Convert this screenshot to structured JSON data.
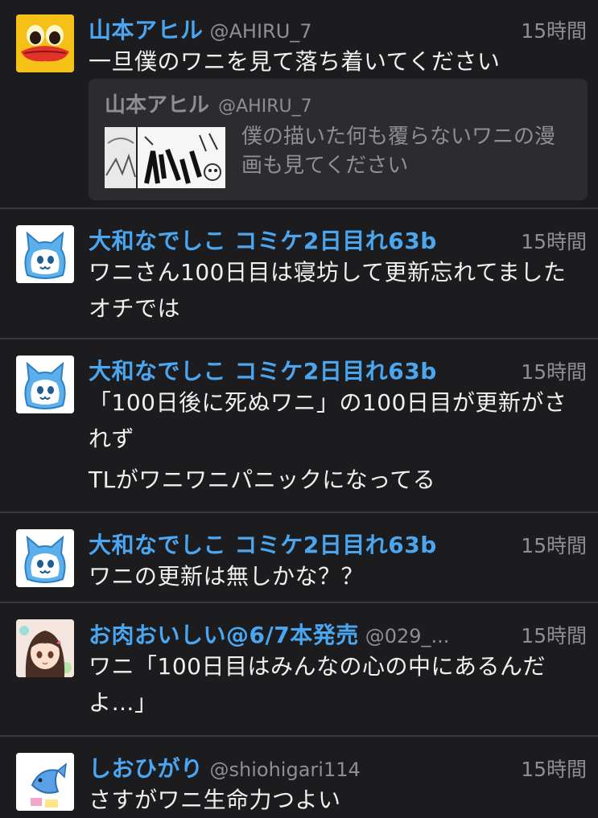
{
  "tweets": [
    {
      "name": "山本アヒル",
      "handle": "@AHIRU_7",
      "time": "15時間",
      "avatar": "duck-avatar",
      "text": [
        "一旦僕のワニを見て落ち着いてください"
      ],
      "quote": {
        "name": "山本アヒル",
        "handle": "@AHIRU_7",
        "text": "僕の描いた何も覆らないワニの漫画も見てください",
        "thumb": "manga-thumbnail"
      }
    },
    {
      "name": "大和なでしこ コミケ2日目れ63b",
      "handle": "",
      "time": "15時間",
      "avatar": "cat-avatar",
      "text": [
        "ワニさん100日目は寝坊して更新忘れてましたオチでは"
      ]
    },
    {
      "name": "大和なでしこ コミケ2日目れ63b",
      "handle": "",
      "time": "15時間",
      "avatar": "cat-avatar",
      "text": [
        "「100日後に死ぬワニ」の100日目が更新がされず",
        "TLがワニワニパニックになってる"
      ]
    },
    {
      "name": "大和なでしこ コミケ2日目れ63b",
      "handle": "",
      "time": "15時間",
      "avatar": "cat-avatar",
      "text": [
        "ワニの更新は無しかな？？"
      ]
    },
    {
      "name": "お肉おいしい@6/7本発売",
      "handle": "@029_...",
      "time": "15時間",
      "avatar": "anime-girl-avatar",
      "text": [
        "ワニ「100日目はみんなの心の中にあるんだよ…」"
      ]
    },
    {
      "name": "しおひがり",
      "handle": "@shiohigari114",
      "time": "15時間",
      "avatar": "fish-avatar",
      "text": [
        "さすがワニ生命力つよい"
      ]
    }
  ],
  "colors": {
    "background": "#1c1c1e",
    "name": "#4aa6f0",
    "meta": "#8e8e93",
    "divider": "#3a3a3c"
  }
}
